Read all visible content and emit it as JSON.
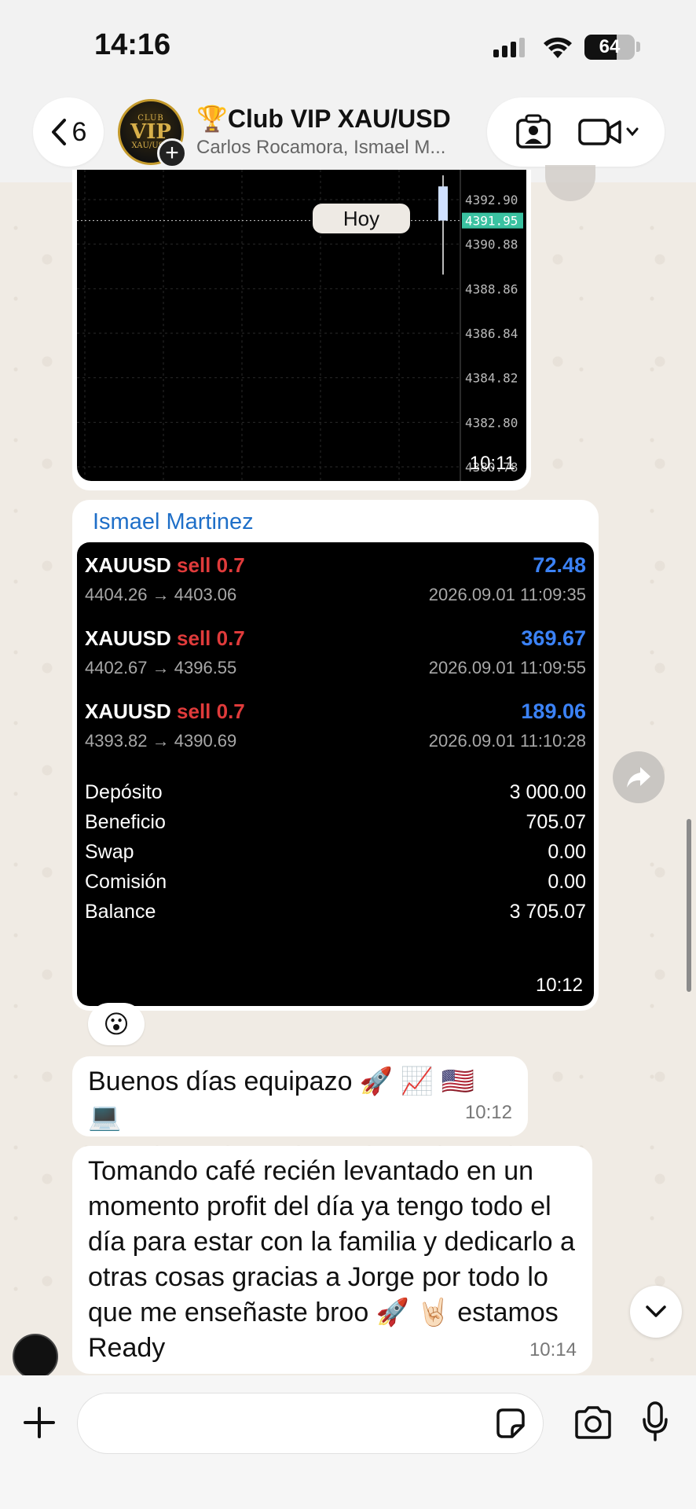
{
  "status_bar": {
    "time": "14:16",
    "battery": "64",
    "battery_level": 0.64
  },
  "header": {
    "back_count": "6",
    "avatar_text": {
      "top": "CLUB",
      "main": "VIP",
      "sub": "XAU/USD"
    },
    "group_name": "🏆Club VIP XAU/USD",
    "members": "Carlos Rocamora, Ismael M...",
    "icons": [
      "chevron-left-icon",
      "contact-card-icon",
      "video-camera-icon",
      "chevron-down-icon"
    ]
  },
  "chart_message": {
    "date_chip": "Hoy",
    "time": "10:11",
    "chart_data": {
      "type": "line",
      "y_ticks": [
        "4392.90",
        "4390.88",
        "4388.86",
        "4386.84",
        "4384.82",
        "4382.80",
        "4380.78"
      ],
      "current_price": "4391.95",
      "grid": true,
      "candle": {
        "open": 4391.95,
        "close": 4393.5,
        "high": 4394.0,
        "low": 4389.5
      },
      "accent_color": "#3ac2a1"
    }
  },
  "positions_message": {
    "sender": "Ismael Martinez",
    "trades": [
      {
        "symbol": "XAUUSD",
        "side": "sell 0.7",
        "prices": "4404.26 → 4403.06",
        "profit": "72.48",
        "date": "2026.09.01 11:09:35"
      },
      {
        "symbol": "XAUUSD",
        "side": "sell 0.7",
        "prices": "4402.67 → 4396.55",
        "profit": "369.67",
        "date": "2026.09.01 11:09:55"
      },
      {
        "symbol": "XAUUSD",
        "side": "sell 0.7",
        "prices": "4393.82 → 4390.69",
        "profit": "189.06",
        "date": "2026.09.01 11:10:28"
      }
    ],
    "summary": [
      {
        "label": "Depósito",
        "value": "3 000.00"
      },
      {
        "label": "Beneficio",
        "value": "705.07"
      },
      {
        "label": "Swap",
        "value": "0.00"
      },
      {
        "label": "Comisión",
        "value": "0.00"
      },
      {
        "label": "Balance",
        "value": "3 705.07"
      }
    ],
    "time": "10:12",
    "reaction": "😮"
  },
  "messages": [
    {
      "text": "Buenos días equipazo 🚀 📈 🇺🇸 💻",
      "time": "10:12"
    },
    {
      "text": "Tomando café recién levantado en un momento profit del día ya tengo todo el día para estar con la familia y dedicarlo a otras cosas gracias a Jorge por todo lo que me enseñaste broo 🚀 🤘🏻 estamos Ready",
      "time": "10:14"
    }
  ],
  "composer": {
    "value": ""
  }
}
